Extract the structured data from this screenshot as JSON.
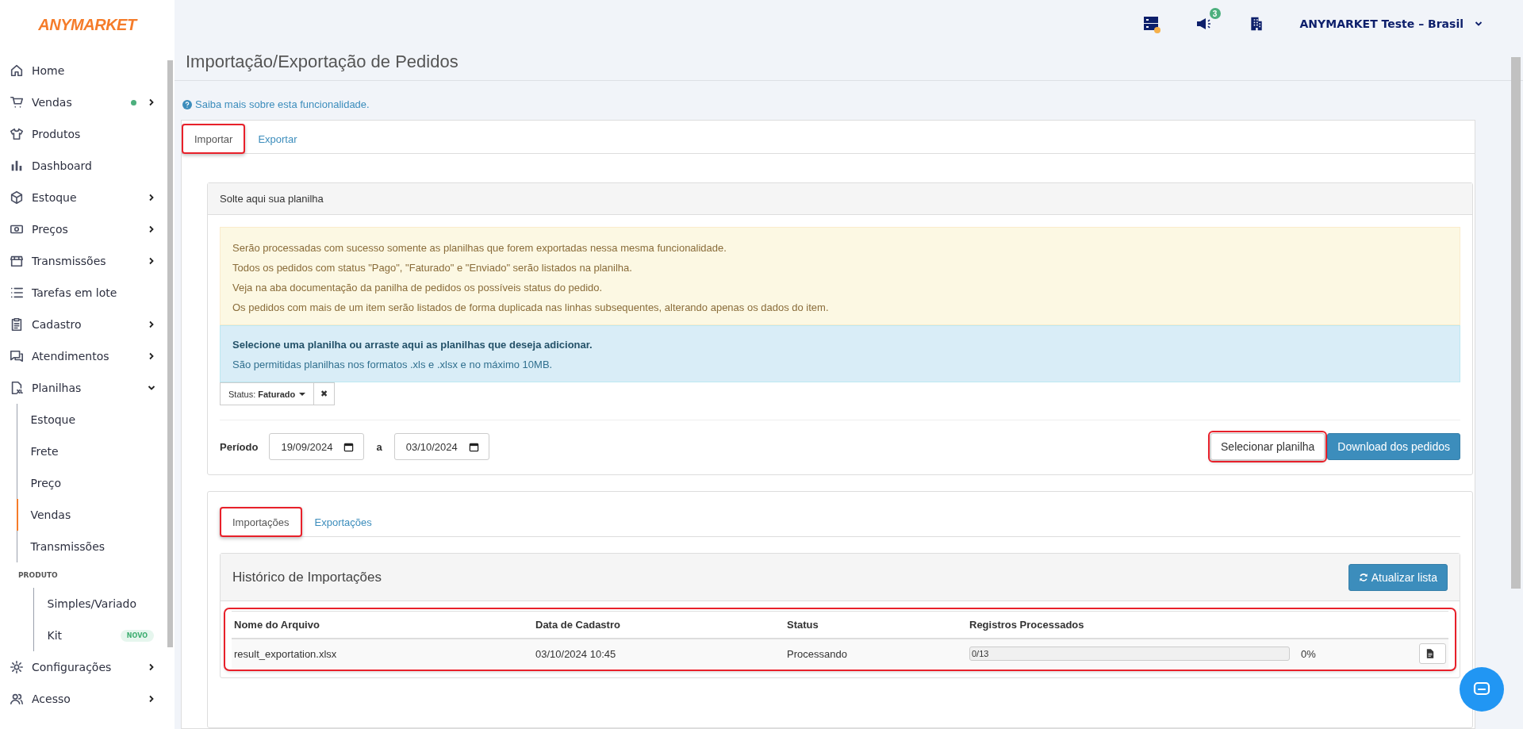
{
  "sidebar": {
    "logo": "ANYMARKET",
    "items": [
      {
        "label": "Home",
        "submenu": false
      },
      {
        "label": "Vendas",
        "submenu": true,
        "expanded": false,
        "dot": {
          "color": "#4caf7d"
        }
      },
      {
        "label": "Produtos",
        "submenu": false
      },
      {
        "label": "Dashboard",
        "submenu": false
      },
      {
        "label": "Estoque",
        "submenu": true,
        "expanded": false
      },
      {
        "label": "Preços",
        "submenu": true,
        "expanded": false
      },
      {
        "label": "Transmissões",
        "submenu": true,
        "expanded": false
      },
      {
        "label": "Tarefas em lote",
        "submenu": false
      },
      {
        "label": "Cadastro",
        "submenu": true,
        "expanded": false
      },
      {
        "label": "Atendimentos",
        "submenu": true,
        "expanded": false
      },
      {
        "label": "Planilhas",
        "submenu": true,
        "expanded": true,
        "children": [
          {
            "kind": "link",
            "label": "Estoque",
            "selected": false
          },
          {
            "kind": "link",
            "label": "Frete",
            "selected": false
          },
          {
            "kind": "link",
            "label": "Preço",
            "selected": false
          },
          {
            "kind": "link",
            "label": "Vendas",
            "selected": true
          },
          {
            "kind": "link",
            "label": "Transmissões",
            "selected": false
          },
          {
            "kind": "heading",
            "label": "PRODUTO",
            "children": [
              {
                "kind": "link",
                "label": "Simples/Variado",
                "selected": false
              },
              {
                "kind": "link",
                "label": "Kit",
                "selected": false,
                "badge": "NOVO"
              }
            ]
          }
        ]
      },
      {
        "label": "Configurações",
        "submenu": true,
        "expanded": false
      },
      {
        "label": "Acesso",
        "submenu": true,
        "expanded": false
      }
    ]
  },
  "topbar": {
    "notifications_badge": "3",
    "account": "ANYMARKET Teste – Brasil"
  },
  "page": {
    "title": "Importação/Exportação de Pedidos",
    "help_link": "Saiba mais sobre esta funcionalidade.",
    "tabs": [
      {
        "label": "Importar",
        "selected": true,
        "highlighted": true
      },
      {
        "label": "Exportar",
        "selected": false,
        "highlighted": false
      }
    ],
    "upload_panel": {
      "title": "Solte aqui sua planilha",
      "warning_lines": [
        "Serão processadas com sucesso somente as planilhas que forem exportadas nessa mesma funcionalidade.",
        "Todos os pedidos com status \"Pago\", \"Faturado\" e \"Enviado\" serão listados na planilha.",
        "Veja na aba documentação da panilha de pedidos os possíveis status do pedido.",
        "Os pedidos com mais de um item serão listados de forma duplicada nas linhas subsequentes, alterando apenas os dados do item."
      ],
      "drop_title": "Selecione uma planilha ou arraste aqui as planilhas que deseja adicionar.",
      "drop_hint": "São permitidas planilhas nos formatos .xls e .xlsx e no máximo 10MB.",
      "status_filter": {
        "label": "Status:",
        "value": "Faturado",
        "clear": "✖"
      },
      "period": {
        "label": "Período",
        "from": "19/09/2024",
        "separator": "a",
        "to": "03/10/2024"
      },
      "buttons": [
        {
          "label": "Selecionar planilha",
          "kind": "default",
          "highlighted": true
        },
        {
          "label": "Download dos pedidos",
          "kind": "primary",
          "highlighted": false
        }
      ]
    },
    "history_tabs": [
      {
        "label": "Importações",
        "selected": true,
        "highlighted": true
      },
      {
        "label": "Exportações",
        "selected": false,
        "highlighted": false
      }
    ],
    "history": {
      "title": "Histórico de Importações",
      "refresh_button": "Atualizar lista",
      "table": {
        "highlighted": true,
        "columns": [
          "Nome do Arquivo",
          "Data de Cadastro",
          "Status",
          "Registros Processados"
        ],
        "rows": [
          {
            "file": "result_exportation.xlsx",
            "date": "03/10/2024 10:45",
            "status": "Processando",
            "progress": {
              "text": "0/13",
              "level": 0,
              "percent": "0%"
            }
          }
        ]
      }
    }
  }
}
